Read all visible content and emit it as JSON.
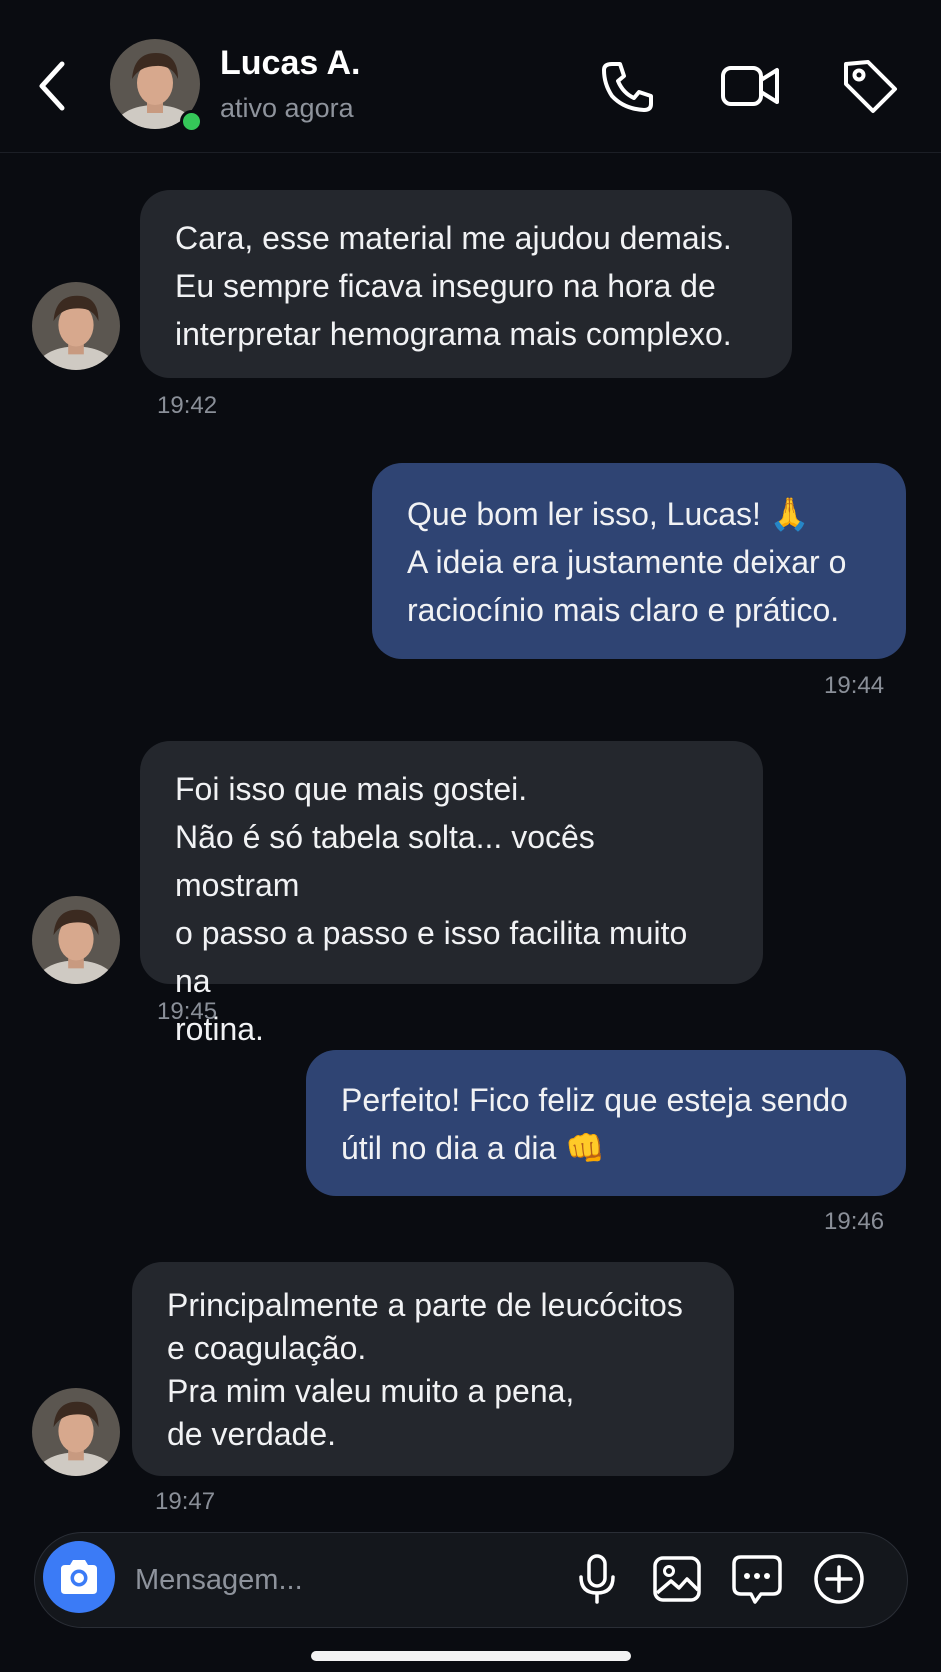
{
  "header": {
    "contact_name": "Lucas A.",
    "status": "ativo agora",
    "icons": [
      "back-chevron-icon",
      "phone-icon",
      "video-icon",
      "tag-icon"
    ]
  },
  "messages": [
    {
      "direction": "incoming",
      "text": "Cara, esse material me ajudou demais.\nEu sempre ficava inseguro na hora de\ninterpretar hemograma mais complexo.",
      "time": "19:42"
    },
    {
      "direction": "outgoing",
      "text": "Que bom ler isso, Lucas! 🙏\nA ideia era justamente deixar o\nraciocínio mais claro e prático.",
      "time": "19:44"
    },
    {
      "direction": "incoming",
      "text": "Foi isso que mais gostei.\nNão é só tabela solta... vocês mostram\no passo a passo e isso facilita muito na\nrotina.",
      "time": "19:45"
    },
    {
      "direction": "outgoing",
      "text": "Perfeito! Fico feliz que esteja sendo\nútil no dia a dia 👊",
      "time": "19:46"
    },
    {
      "direction": "incoming",
      "text": "Principalmente a parte de leucócitos\ne coagulação.\nPra mim valeu muito a pena,\nde verdade.",
      "time": "19:47"
    }
  ],
  "composer": {
    "placeholder": "Mensagem...",
    "value": "",
    "icons": [
      "camera-icon",
      "microphone-icon",
      "image-icon",
      "chat-bubble-icon",
      "add-icon"
    ]
  },
  "colors": {
    "background": "#0a0c11",
    "incoming_bubble": "#24272d",
    "outgoing_bubble": "#2f4473",
    "online": "#35c759",
    "accent": "#3b7bf6"
  }
}
